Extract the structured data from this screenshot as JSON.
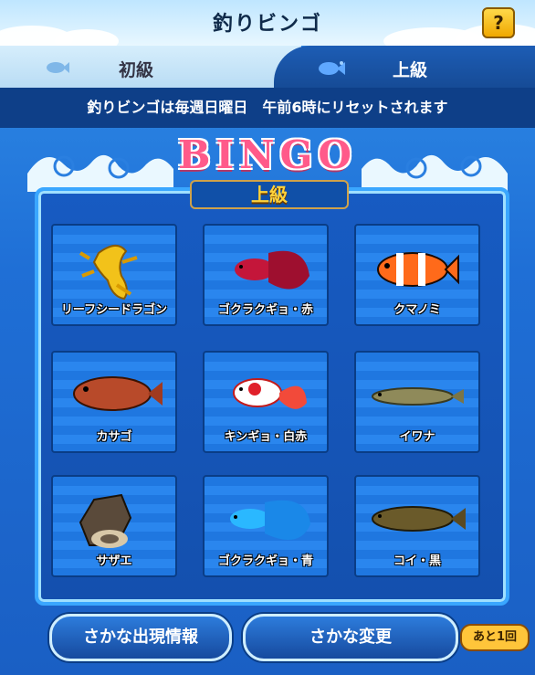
{
  "header": {
    "title": "釣りビンゴ",
    "help_label": "?"
  },
  "tabs": [
    {
      "label": "初級",
      "icon": "fish-icon",
      "active": false
    },
    {
      "label": "上級",
      "icon": "fish-icon",
      "active": true
    }
  ],
  "notice": "釣りビンゴは毎週日曜日　午前6時にリセットされます",
  "bingo": {
    "title": "BINGO",
    "level": "上級"
  },
  "cells": [
    {
      "label": "リーフシードラゴン",
      "icon": "leafy-seadragon-icon"
    },
    {
      "label": "ゴクラクギョ・赤",
      "icon": "betta-red-icon"
    },
    {
      "label": "クマノミ",
      "icon": "clownfish-icon"
    },
    {
      "label": "カサゴ",
      "icon": "scorpionfish-icon"
    },
    {
      "label": "キンギョ・白赤",
      "icon": "goldfish-icon"
    },
    {
      "label": "イワナ",
      "icon": "char-icon"
    },
    {
      "label": "サザエ",
      "icon": "turban-shell-icon"
    },
    {
      "label": "ゴクラクギョ・青",
      "icon": "betta-blue-icon"
    },
    {
      "label": "コイ・黒",
      "icon": "carp-black-icon"
    }
  ],
  "buttons": {
    "appearance_info": "さかな出現情報",
    "change_fish": "さかな変更",
    "remaining": "あと1回"
  }
}
